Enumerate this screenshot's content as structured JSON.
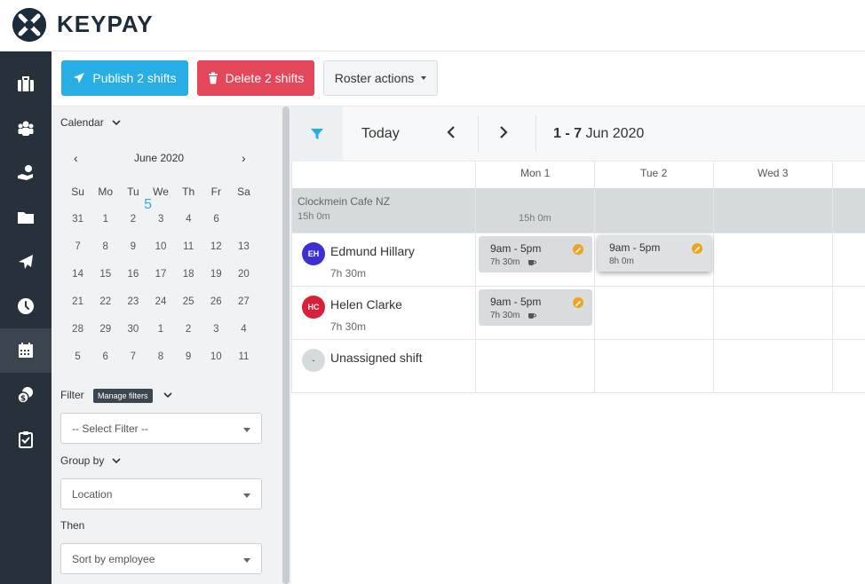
{
  "brand": {
    "name": "KEYPAY",
    "colors": {
      "accent": "#28aee5",
      "danger": "#e5475a",
      "nav": "#27313b",
      "warning": "#f0a41c"
    }
  },
  "nav": {
    "items": [
      {
        "icon": "briefcase-icon"
      },
      {
        "icon": "people-icon"
      },
      {
        "icon": "hand-coin-icon"
      },
      {
        "icon": "folder-icon"
      },
      {
        "icon": "plane-icon"
      },
      {
        "icon": "clock-icon"
      },
      {
        "icon": "calendar-icon",
        "active": true
      },
      {
        "icon": "money-bag-icon"
      },
      {
        "icon": "clipboard-check-icon"
      }
    ]
  },
  "toolbar": {
    "publish_label": "Publish 2 shifts",
    "delete_label": "Delete 2 shifts",
    "roster_label": "Roster actions"
  },
  "sidebar": {
    "calendar_label": "Calendar",
    "month_label": "June 2020",
    "prev": "‹",
    "next": "›",
    "dow": [
      "Su",
      "Mo",
      "Tu",
      "We",
      "Th",
      "Fr",
      "Sa"
    ],
    "weeks": [
      [
        "31",
        "1",
        "2",
        "3",
        "4",
        "5",
        "6"
      ],
      [
        "7",
        "8",
        "9",
        "10",
        "11",
        "12",
        "13"
      ],
      [
        "14",
        "15",
        "16",
        "17",
        "18",
        "19",
        "20"
      ],
      [
        "21",
        "22",
        "23",
        "24",
        "25",
        "26",
        "27"
      ],
      [
        "28",
        "29",
        "30",
        "1",
        "2",
        "3",
        "4"
      ],
      [
        "5",
        "6",
        "7",
        "8",
        "9",
        "10",
        "11"
      ]
    ],
    "today": "5",
    "filter_label": "Filter",
    "manage_filters": "Manage filters",
    "filter_placeholder": "-- Select Filter --",
    "group_by_label": "Group by",
    "group_by_value": "Location",
    "then_label": "Then",
    "then_value": "Sort by employee"
  },
  "roster": {
    "today_label": "Today",
    "prev": "‹",
    "next": "›",
    "range_bold": "1 - 7",
    "range_rest": "Jun 2020",
    "days": [
      "Mon 1",
      "Tue 2",
      "Wed 3"
    ],
    "location": {
      "name": "Clockmein Cafe NZ",
      "hours": "15h 0m",
      "mon_hours": "15h 0m"
    },
    "employees": [
      {
        "initials": "EH",
        "name": "Edmund Hillary",
        "hours": "7h 30m",
        "color": "#3d2fd1"
      },
      {
        "initials": "HC",
        "name": "Helen Clarke",
        "hours": "7h 30m",
        "color": "#d9203a"
      },
      {
        "initials": "-",
        "name": "Unassigned shift",
        "hours": "",
        "color": "#d5dadd"
      }
    ],
    "shifts": [
      {
        "time": "9am - 5pm",
        "length": "7h 30m"
      },
      {
        "time": "9am - 5pm",
        "length": "8h 0m"
      },
      {
        "time": "9am - 5pm",
        "length": "7h 30m"
      }
    ]
  }
}
